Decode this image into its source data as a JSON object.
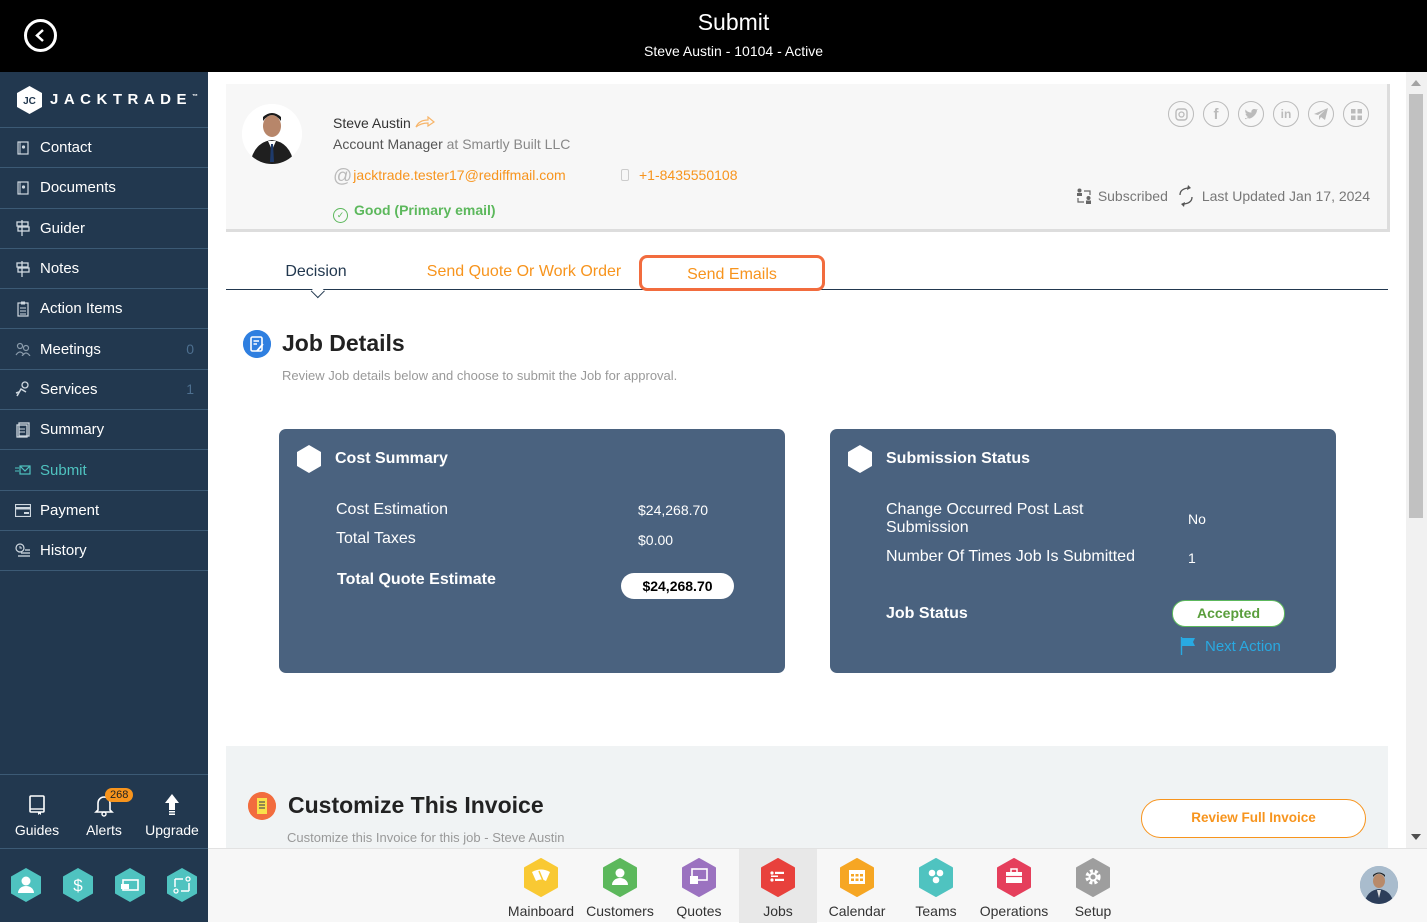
{
  "header": {
    "title": "Submit",
    "subtitle": "Steve Austin - 10104 - Active",
    "back_icon": "back-arrow-circle-icon"
  },
  "sidebar": {
    "logo_text": "JACKTRADE",
    "logo_tm": "™",
    "items": [
      {
        "label": "Contact",
        "icon": "contact-book-icon",
        "count": null,
        "active": false
      },
      {
        "label": "Documents",
        "icon": "documents-icon",
        "count": null,
        "active": false
      },
      {
        "label": "Guider",
        "icon": "signpost-icon",
        "count": null,
        "active": false
      },
      {
        "label": "Notes",
        "icon": "signpost-icon",
        "count": null,
        "active": false
      },
      {
        "label": "Action Items",
        "icon": "clipboard-list-icon",
        "count": null,
        "active": false
      },
      {
        "label": "Meetings",
        "icon": "meetings-icon",
        "count": "0",
        "active": false
      },
      {
        "label": "Services",
        "icon": "services-icon",
        "count": "1",
        "active": false
      },
      {
        "label": "Summary",
        "icon": "summary-icon",
        "count": null,
        "active": false
      },
      {
        "label": "Submit",
        "icon": "submit-mail-icon",
        "count": null,
        "active": true
      },
      {
        "label": "Payment",
        "icon": "payment-card-icon",
        "count": null,
        "active": false
      },
      {
        "label": "History",
        "icon": "history-icon",
        "count": null,
        "active": false
      }
    ],
    "bottom": {
      "guides": "Guides",
      "alerts": "Alerts",
      "alerts_badge": "268",
      "upgrade": "Upgrade"
    },
    "quick_icons": [
      "person-hex-icon",
      "dollar-hex-icon",
      "money-hex-icon",
      "workflow-hex-icon"
    ],
    "accent_color": "#4fc3c0"
  },
  "contact": {
    "name": "Steve Austin",
    "role": "Account Manager",
    "at": "at",
    "company": "Smartly Built LLC",
    "email": "jacktrade.tester17@rediffmail.com",
    "email_prefix": "@",
    "phone": "+1-8435550108",
    "email_status": "Good (Primary email)",
    "subscribed": "Subscribed",
    "last_updated": "Last Updated Jan 17, 2024",
    "socials": [
      "instagram-icon",
      "facebook-icon",
      "twitter-icon",
      "linkedin-icon",
      "telegram-icon",
      "apps-icon"
    ]
  },
  "tabs": [
    {
      "label": "Decision",
      "active": true
    },
    {
      "label": "Send Quote Or Work Order",
      "active": false
    },
    {
      "label": "Send Emails",
      "active": false,
      "highlighted": true
    }
  ],
  "job_details": {
    "title": "Job Details",
    "subtitle": "Review Job details below and choose to submit the Job for approval."
  },
  "cost_summary": {
    "title": "Cost Summary",
    "rows": [
      {
        "label": "Cost Estimation",
        "value": "$24,268.70"
      },
      {
        "label": "Total Taxes",
        "value": "$0.00"
      }
    ],
    "total_label": "Total Quote Estimate",
    "total_value": "$24,268.70"
  },
  "submission_status": {
    "title": "Submission Status",
    "rows": [
      {
        "label": "Change Occurred Post Last Submission",
        "value": "No"
      },
      {
        "label": "Number Of Times Job Is Submitted",
        "value": "1"
      }
    ],
    "job_status_label": "Job Status",
    "job_status_value": "Accepted",
    "next_action": "Next Action"
  },
  "invoice": {
    "title": "Customize This Invoice",
    "subtitle": "Customize this Invoice for this job - Steve Austin",
    "review_button": "Review Full Invoice"
  },
  "bottom_nav": [
    {
      "label": "Mainboard",
      "color": "#f9c933",
      "icon": "mainboard-icon",
      "active": false
    },
    {
      "label": "Customers",
      "color": "#5cb85c",
      "icon": "customers-icon",
      "active": false
    },
    {
      "label": "Quotes",
      "color": "#9b72c0",
      "icon": "quotes-icon",
      "active": false
    },
    {
      "label": "Jobs",
      "color": "#e8413c",
      "icon": "jobs-icon",
      "active": true
    },
    {
      "label": "Calendar",
      "color": "#f6a623",
      "icon": "calendar-icon",
      "active": false
    },
    {
      "label": "Teams",
      "color": "#4fc3c0",
      "icon": "teams-icon",
      "active": false
    },
    {
      "label": "Operations",
      "color": "#e53f5c",
      "icon": "operations-icon",
      "active": false
    },
    {
      "label": "Setup",
      "color": "#9e9e9e",
      "icon": "setup-gear-icon",
      "active": false
    }
  ],
  "colors": {
    "brand_orange": "#f7941d",
    "sidebar_bg": "#22384f",
    "panel_bg": "#4a627f",
    "good_green": "#5cb85c",
    "link_blue": "#29a9e1"
  }
}
